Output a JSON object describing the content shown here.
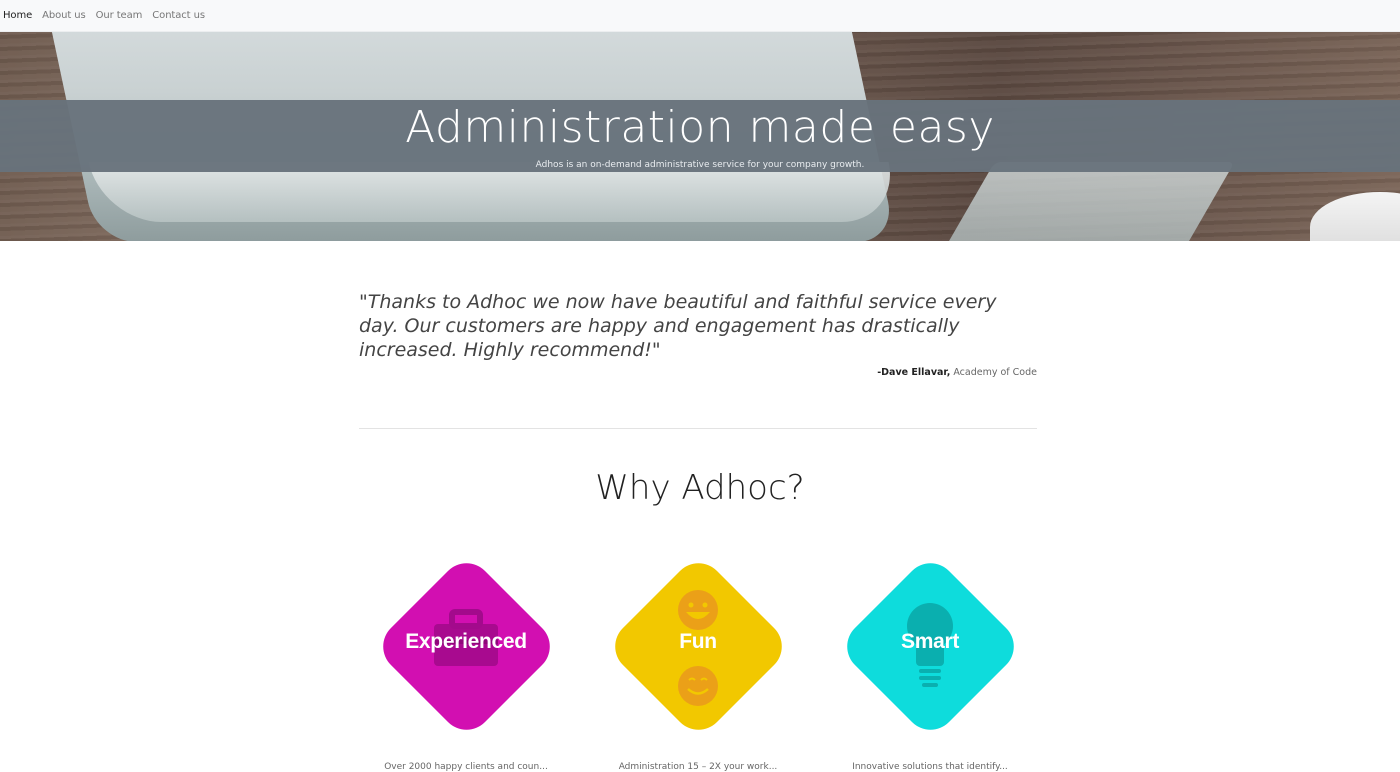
{
  "nav": {
    "items": [
      {
        "label": "Home",
        "active": true
      },
      {
        "label": "About us",
        "active": false
      },
      {
        "label": "Our team",
        "active": false
      },
      {
        "label": "Contact us",
        "active": false
      }
    ]
  },
  "hero": {
    "title": "Administration made easy",
    "subtitle": "Adhos is an on-demand administrative service for your company growth."
  },
  "testimonial": {
    "quote": "\"Thanks to Adhoc we now have beautiful and faithful service every day. Our customers are happy and engagement has drastically increased. Highly recommend!\"",
    "author": "-Dave Ellavar,",
    "company": " Academy of Code"
  },
  "why": {
    "title": "Why Adhoc?",
    "features": [
      {
        "label": "Experienced",
        "color": "#d20fb1",
        "icon": "briefcase-icon",
        "blurb": "Over 2000 happy clients and coun..."
      },
      {
        "label": "Fun",
        "color": "#f2c800",
        "icon": "smiley-icon",
        "blurb": "Administration 15 – 2X your work..."
      },
      {
        "label": "Smart",
        "color": "#0edcdc",
        "icon": "lightbulb-icon",
        "blurb": "Innovative solutions that identify..."
      }
    ]
  }
}
